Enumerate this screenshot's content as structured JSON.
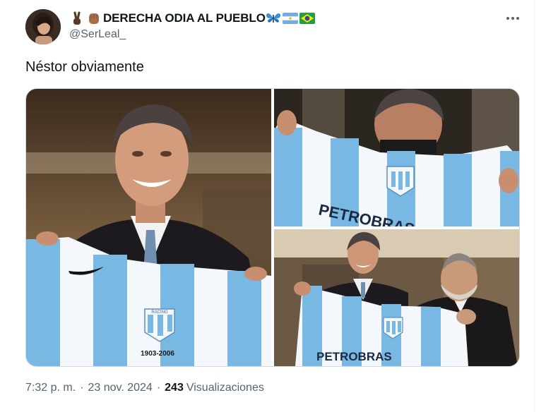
{
  "author": {
    "display_name": "DERECHA ODIA AL PUEBLO",
    "handle": "@SerLeal_",
    "name_icons": [
      "victory-hand-icon",
      "raised-fist-icon",
      "butterfly-icon",
      "argentina-flag-icon",
      "brazil-flag-icon"
    ]
  },
  "tweet": {
    "text": "Néstor obviamente",
    "time": "7:32 p. m.",
    "separator": "·",
    "date": "23 nov. 2024",
    "views_count": "243",
    "views_label": "Visualizaciones"
  },
  "media": {
    "photo_count": 3,
    "jersey_text": {
      "crest": "RACING",
      "years": "1903-2006",
      "sponsor": "PETROBRAS"
    }
  },
  "colors": {
    "text_primary": "#0f1419",
    "text_secondary": "#536471",
    "border": "#cfd9de",
    "jersey_blue": "#7ab8e4",
    "jersey_white": "#f4f7fb"
  }
}
